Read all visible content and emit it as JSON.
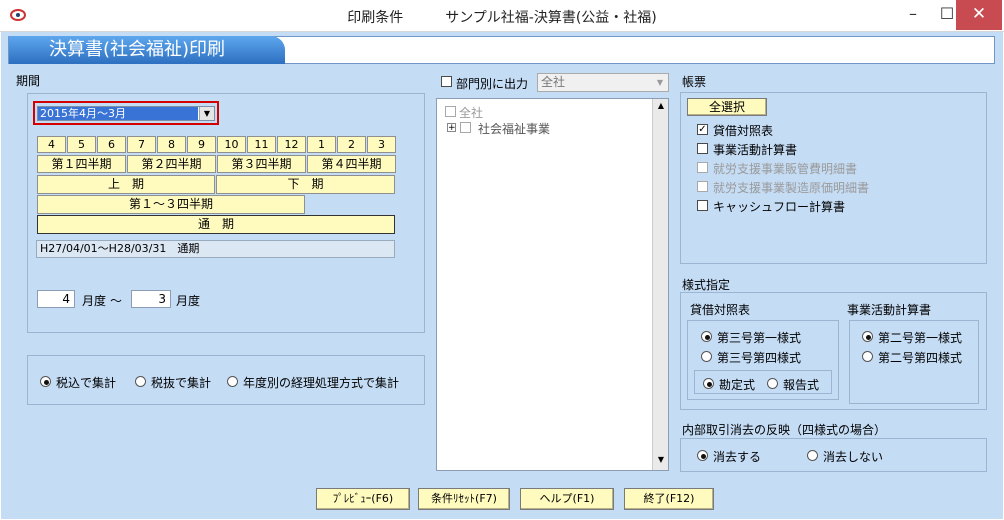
{
  "window": {
    "title": "印刷条件　　　サンプル社福-決算書(公益・社福)",
    "min": "–",
    "max": "☐",
    "close": "✕"
  },
  "header": {
    "tab_title": "決算書(社会福祉)印刷"
  },
  "period": {
    "label": "期間",
    "selected": "2015年4月〜3月",
    "months": [
      "4",
      "5",
      "6",
      "7",
      "8",
      "9",
      "10",
      "11",
      "12",
      "1",
      "2",
      "3"
    ],
    "quarters": [
      "第１四半期",
      "第２四半期",
      "第３四半期",
      "第４四半期"
    ],
    "halves": [
      "上　期",
      "下　期"
    ],
    "q1to3": "第１〜３四半期",
    "full": "通　期",
    "info": "H27/04/01〜H28/03/31　通期",
    "from_month": "4",
    "to_month": "3",
    "month_unit": "月度",
    "tilde": "〜"
  },
  "tax": {
    "options": [
      "税込で集計",
      "税抜で集計",
      "年度別の経理処理方式で集計"
    ],
    "selected": 0
  },
  "dept": {
    "checkbox_label": "部門別に出力",
    "select_value": "全社",
    "tree": [
      "全社",
      "社会福祉事業"
    ],
    "tree_expand": "+"
  },
  "forms": {
    "label": "帳票",
    "select_all": "全選択",
    "items": [
      {
        "label": "貸借対照表",
        "checked": true,
        "enabled": true
      },
      {
        "label": "事業活動計算書",
        "checked": false,
        "enabled": true
      },
      {
        "label": "就労支援事業販管費明細書",
        "checked": false,
        "enabled": false
      },
      {
        "label": "就労支援事業製造原価明細書",
        "checked": false,
        "enabled": false
      },
      {
        "label": "キャッシュフロー計算書",
        "checked": false,
        "enabled": true
      }
    ],
    "check_mark": "✓"
  },
  "style": {
    "label": "様式指定",
    "bs_label": "貸借対照表",
    "bs_options": [
      "第三号第一様式",
      "第三号第四様式"
    ],
    "bs_sub_options": [
      "勘定式",
      "報告式"
    ],
    "pl_label": "事業活動計算書",
    "pl_options": [
      "第二号第一様式",
      "第二号第四様式"
    ]
  },
  "elim": {
    "label": "内部取引消去の反映（四様式の場合）",
    "options": [
      "消去する",
      "消去しない"
    ]
  },
  "buttons": {
    "preview": "ﾌﾟﾚﾋﾞｭｰ(F6)",
    "reset": "条件ﾘｾｯﾄ(F7)",
    "help": "ヘルプ(F1)",
    "exit": "終了(F12)"
  },
  "colors": {
    "client_bg": "#c5dcf5",
    "button_bg": "#fffbbf",
    "header_tab": "#3c83d6",
    "highlight": "#d40000",
    "close_btn": "#c74b50"
  }
}
